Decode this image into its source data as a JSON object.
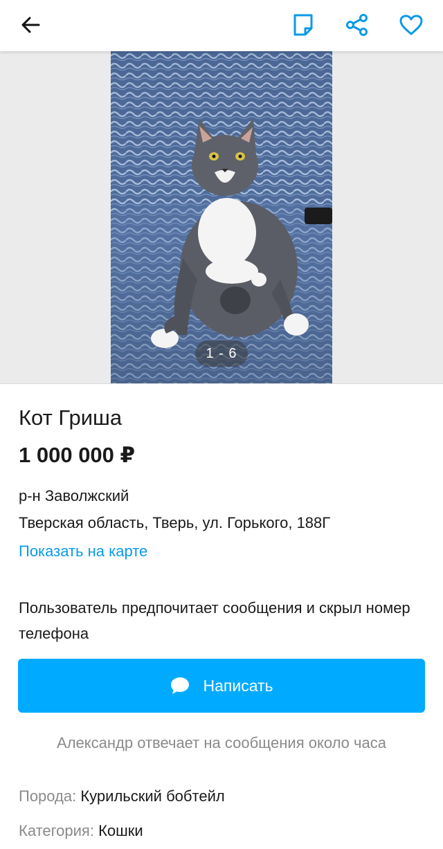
{
  "header": {
    "back_icon": "arrow-left-icon",
    "note_icon": "note-icon",
    "share_icon": "share-icon",
    "favorite_icon": "heart-icon",
    "accent_color": "#0a9ae8"
  },
  "gallery": {
    "counter": "1 - 6"
  },
  "listing": {
    "title": "Кот Гриша",
    "price": "1 000 000 ₽",
    "district": "р-н Заволжский",
    "address": "Тверская область, Тверь, ул. Горького, 188Г",
    "map_link": "Показать на карте",
    "contact_notice": "Пользователь предпочитает сообщения и скрыл номер телефона",
    "write_button": "Написать",
    "write_button_color": "#00aaff",
    "reply_time": "Александр отвечает на сообщения около часа"
  },
  "attributes": [
    {
      "key": "Порода:",
      "value": "Курильский бобтейл"
    },
    {
      "key": "Категория:",
      "value": "Кошки"
    }
  ]
}
